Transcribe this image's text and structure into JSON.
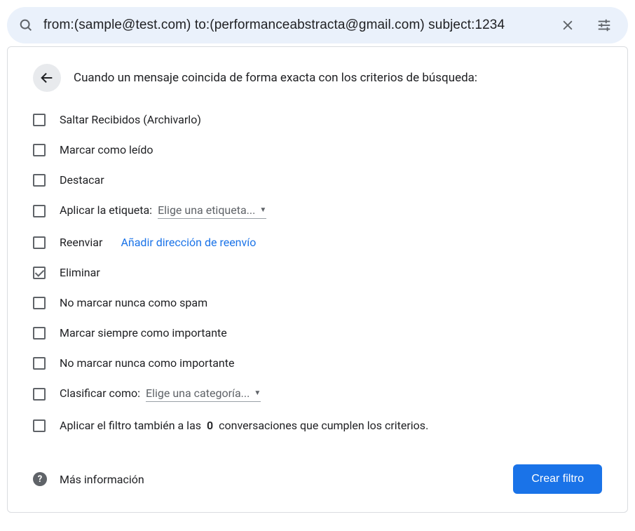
{
  "search": {
    "query": "from:(sample@test.com) to:(performanceabstracta@gmail.com) subject:1234"
  },
  "panel": {
    "title": "Cuando un mensaje coincida de forma exacta con los criterios de búsqueda:"
  },
  "options": {
    "skip_inbox": {
      "label": "Saltar Recibidos (Archivarlo)",
      "checked": false
    },
    "mark_read": {
      "label": "Marcar como leído",
      "checked": false
    },
    "star": {
      "label": "Destacar",
      "checked": false
    },
    "apply_label": {
      "label": "Aplicar la etiqueta:",
      "dropdown": "Elige una etiqueta...",
      "checked": false
    },
    "forward": {
      "label": "Reenviar",
      "link": "Añadir dirección de reenvío",
      "checked": false
    },
    "delete": {
      "label": "Eliminar",
      "checked": true
    },
    "never_spam": {
      "label": "No marcar nunca como spam",
      "checked": false
    },
    "always_important": {
      "label": "Marcar siempre como importante",
      "checked": false
    },
    "never_important": {
      "label": "No marcar nunca como importante",
      "checked": false
    },
    "categorize": {
      "label": "Clasificar como:",
      "dropdown": "Elige una categoría...",
      "checked": false
    },
    "apply_existing": {
      "prefix": "Aplicar el filtro también a las ",
      "count": "0",
      "suffix": " conversaciones que cumplen los criterios.",
      "checked": false
    }
  },
  "footer": {
    "more_info": "Más información",
    "create_button": "Crear filtro"
  }
}
